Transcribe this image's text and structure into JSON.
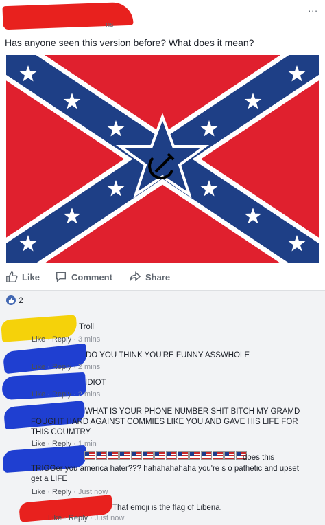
{
  "post": {
    "author_tail": "ns",
    "more": "...",
    "text": "Has anyone seen this version before? What does it mean?"
  },
  "actions": {
    "like": "Like",
    "comment": "Comment",
    "share": "Share"
  },
  "reactions": {
    "count": "2"
  },
  "comments": [
    {
      "text": "Troll",
      "like": "Like",
      "reply": "Reply",
      "time": "3 mins"
    },
    {
      "text": "DO YOU THINK YOU'RE FUNNY ASSWHOLE",
      "like": "Like",
      "reply": "Reply",
      "time": "2 mins"
    },
    {
      "text": "IDIOT",
      "like": "Like",
      "reply": "Reply",
      "time": "2 mins"
    },
    {
      "line1": "WHAT IS YOUR PHONE NUMBER SHIT BITCH MY GRAMD",
      "line2": "FOUGHT HARD AGAINST COMMIES LIKE YOU AND GAVE HIS LIFE FOR",
      "line3": "THIS COUMTRY",
      "like": "Like",
      "reply": "Reply",
      "time": "1 min"
    },
    {
      "tail": "does this",
      "line2": "TRIGGer you america hater??? hahahahahaha you're s o pathetic and upset",
      "line3": "get a LIFE",
      "like": "Like",
      "reply": "Reply",
      "time": "Just now"
    },
    {
      "text": "That emoji is the flag of Liberia.",
      "like": "Like",
      "reply": "Reply",
      "time": "Just now"
    }
  ],
  "colors": {
    "red_redaction": "#e8211e",
    "blue_redaction": "#1f3fd1",
    "yellow_redaction": "#f5d20a",
    "flag_red": "#e0202e",
    "flag_blue": "#1e3f86"
  }
}
